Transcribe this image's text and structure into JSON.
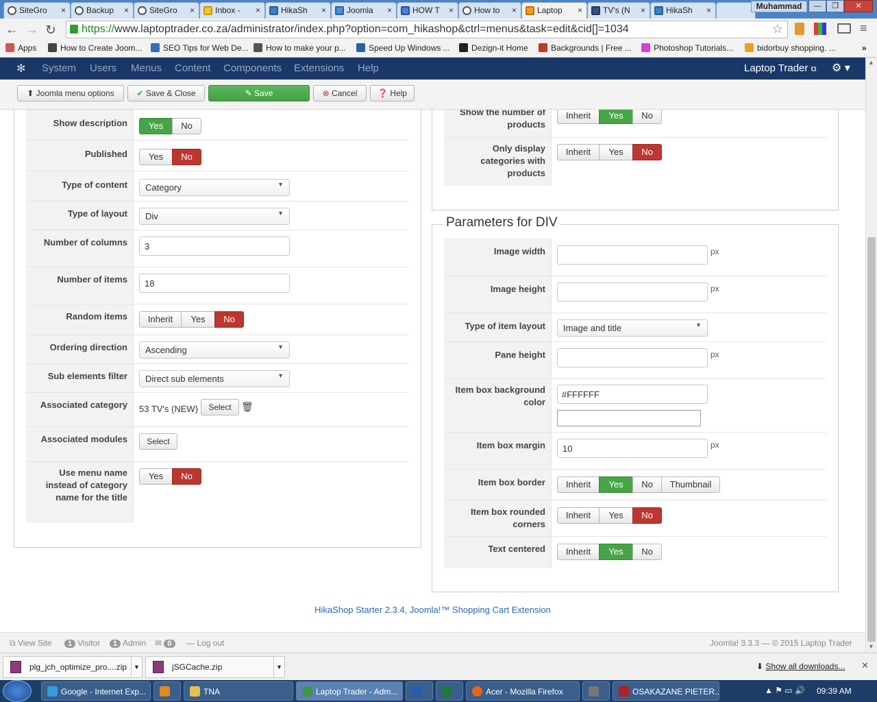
{
  "browser": {
    "tabs": [
      {
        "label": "SiteGro",
        "active": false
      },
      {
        "label": "Backup",
        "active": false
      },
      {
        "label": "SiteGro",
        "active": false
      },
      {
        "label": "Inbox -",
        "active": false
      },
      {
        "label": "HikaSh",
        "active": false
      },
      {
        "label": "Joomla",
        "active": false
      },
      {
        "label": "HOW T",
        "active": false
      },
      {
        "label": "How to",
        "active": false
      },
      {
        "label": "Laptop",
        "active": true
      },
      {
        "label": "TV's (N",
        "active": false
      },
      {
        "label": "HikaSh",
        "active": false
      }
    ],
    "user": "Muhammad",
    "url_scheme": "https://",
    "url_rest": "www.laptoptrader.co.za/administrator/index.php?option=com_hikashop&ctrl=menus&task=edit&cid[]=1034",
    "bookmarks": [
      {
        "label": "Apps",
        "color": "#d9534f"
      },
      {
        "label": "How to Create Joom...",
        "color": "#444444"
      },
      {
        "label": "SEO Tips for Web De...",
        "color": "#2f6fbf"
      },
      {
        "label": "How to make your p...",
        "color": "#555555"
      },
      {
        "label": "Speed Up Windows ...",
        "color": "#2b5faa"
      },
      {
        "label": "Dezign-it Home",
        "color": "#222222"
      },
      {
        "label": "Backgrounds | Free ...",
        "color": "#c0392b"
      },
      {
        "label": "Photoshop Tutorials...",
        "color": "#d63fd6"
      },
      {
        "label": "bidorbuy shopping. ...",
        "color": "#e8a317"
      }
    ]
  },
  "admin_nav": {
    "menus": [
      "System",
      "Users",
      "Menus",
      "Content",
      "Components",
      "Extensions",
      "Help"
    ],
    "site_name": "Laptop Trader"
  },
  "toolbar": {
    "menu_options": "Joomla menu options",
    "save_close": "Save & Close",
    "save": "Save",
    "cancel": "Cancel",
    "help": "Help"
  },
  "left_form": {
    "show_description": {
      "label": "Show description",
      "options": [
        "Yes",
        "No"
      ],
      "selected": "Yes"
    },
    "published": {
      "label": "Published",
      "options": [
        "Yes",
        "No"
      ],
      "selected": "No"
    },
    "type_of_content": {
      "label": "Type of content",
      "value": "Category"
    },
    "type_of_layout": {
      "label": "Type of layout",
      "value": "Div"
    },
    "number_of_columns": {
      "label": "Number of columns",
      "value": "3"
    },
    "number_of_items": {
      "label": "Number of items",
      "value": "18"
    },
    "random_items": {
      "label": "Random items",
      "options": [
        "Inherit",
        "Yes",
        "No"
      ],
      "selected": "No"
    },
    "ordering_direction": {
      "label": "Ordering direction",
      "value": "Ascending"
    },
    "sub_elements_filter": {
      "label": "Sub elements filter",
      "value": "Direct sub elements"
    },
    "associated_category": {
      "label": "Associated category",
      "value": "53 TV's (NEW)",
      "button": "Select"
    },
    "associated_modules": {
      "label": "Associated modules",
      "button": "Select"
    },
    "use_menu_name": {
      "label": "Use menu name instead of category name for the title",
      "options": [
        "Yes",
        "No"
      ],
      "selected": "No"
    }
  },
  "right_top": {
    "show_number_of_products": {
      "label": "Show the number of products",
      "options": [
        "Inherit",
        "Yes",
        "No"
      ],
      "selected": "Yes"
    },
    "only_display_categories": {
      "label": "Only display categories with products",
      "options": [
        "Inherit",
        "Yes",
        "No"
      ],
      "selected": "No"
    }
  },
  "div_params": {
    "legend": "Parameters for DIV",
    "unit": "px",
    "image_width": {
      "label": "Image width",
      "value": ""
    },
    "image_height": {
      "label": "Image height",
      "value": ""
    },
    "type_of_item_layout": {
      "label": "Type of item layout",
      "value": "Image and title"
    },
    "pane_height": {
      "label": "Pane height",
      "value": ""
    },
    "item_box_background_color": {
      "label": "Item box background color",
      "value": "#FFFFFF"
    },
    "item_box_margin": {
      "label": "Item box margin",
      "value": "10"
    },
    "item_box_border": {
      "label": "Item box border",
      "options": [
        "Inherit",
        "Yes",
        "No",
        "Thumbnail"
      ],
      "selected": "Yes"
    },
    "item_box_rounded_corners": {
      "label": "Item box rounded corners",
      "options": [
        "Inherit",
        "Yes",
        "No"
      ],
      "selected": "No"
    },
    "text_centered": {
      "label": "Text centered",
      "options": [
        "Inherit",
        "Yes",
        "No"
      ],
      "selected": "Yes"
    }
  },
  "footer": {
    "hikashop": "HikaShop Starter 2.3.4, Joomla!™ Shopping Cart Extension",
    "view_site": "View Site",
    "visitor_count": "1",
    "visitor_label": "Visitor",
    "admin_count": "1",
    "admin_label": "Admin",
    "message_count": "0",
    "logout": "Log out",
    "copyright": "Joomla! 3.3.3 — © 2015 Laptop Trader"
  },
  "downloads": {
    "files": [
      "plg_jch_optimize_pro....zip",
      "jSGCache.zip"
    ],
    "show_all": "Show all downloads..."
  },
  "taskbar": {
    "items": [
      {
        "label": "Google - Internet Exp...",
        "color": "#3a9ad9"
      },
      {
        "label": "",
        "color": "#e28a1c"
      },
      {
        "label": "TNA",
        "color": "#e8c24a"
      },
      {
        "label": "Laptop Trader - Adm...",
        "color": "#3c9a3c"
      },
      {
        "label": "",
        "color": "#2a5caa"
      },
      {
        "label": "",
        "color": "#1f7a3a"
      },
      {
        "label": "Acer - Mozilla Firefox",
        "color": "#e8641b"
      },
      {
        "label": "",
        "color": "#777777"
      },
      {
        "label": "OSAKAZANE PIETER...",
        "color": "#b22222"
      }
    ],
    "time": "09:39 AM"
  },
  "colors": {
    "nav_bg": "#1a3867",
    "success": "#46a546",
    "danger": "#bd362f",
    "link": "#2a6ab4"
  }
}
